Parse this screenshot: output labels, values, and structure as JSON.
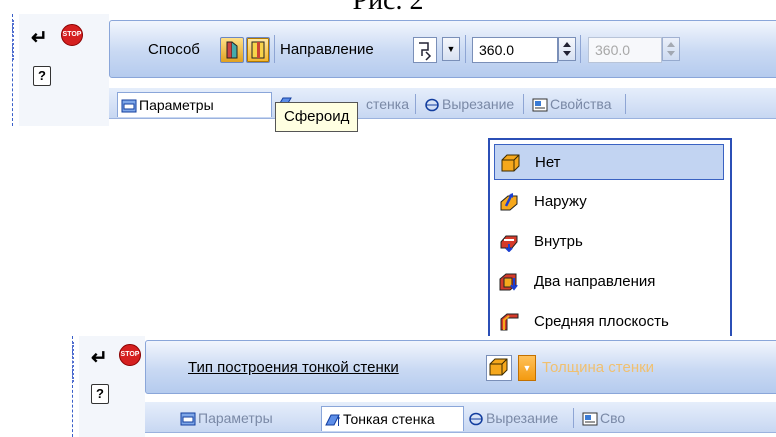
{
  "caption": "Рис. 2",
  "toolbar1": {
    "method_label": "Способ",
    "direction_label": "Направление",
    "angle1": "360.0",
    "angle2": "360.0",
    "tabs": {
      "params": "Параметры",
      "thin_wall_partial": "стенка",
      "cut": "Вырезание",
      "props": "Свойства"
    },
    "tooltip": "Сфероид"
  },
  "dropdown": {
    "items": [
      {
        "label": "Нет",
        "icon": "box-none-icon"
      },
      {
        "label": "Наружу",
        "icon": "wall-outward-icon"
      },
      {
        "label": "Внутрь",
        "icon": "wall-inward-icon"
      },
      {
        "label": "Два направления",
        "icon": "wall-two-directions-icon"
      },
      {
        "label": "Средняя плоскость",
        "icon": "wall-midplane-icon"
      }
    ],
    "selected": "Нет"
  },
  "toolbar2": {
    "type_label": "Тип построения тонкой стенки",
    "thickness_label": "Толщина стенки",
    "tabs": {
      "params": "Параметры",
      "thin_wall": "Тонкая стенка",
      "cut": "Вырезание",
      "props": "Сво"
    }
  },
  "colors": {
    "accent": "#2b4fb6",
    "toolbar_bg": "#c9d9f3",
    "stop": "#d52020",
    "selection": "#c2d4f2"
  }
}
